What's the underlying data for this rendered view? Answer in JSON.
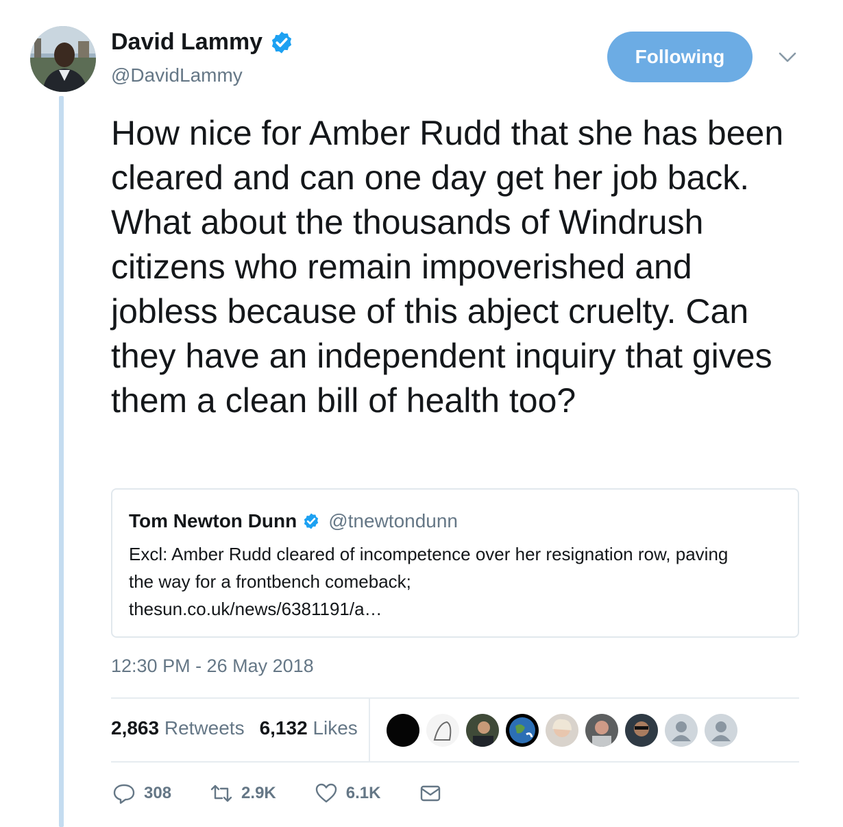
{
  "author": {
    "name": "David Lammy",
    "handle": "@DavidLammy",
    "verified": true
  },
  "follow_button": {
    "label": "Following"
  },
  "tweet": {
    "text": "How nice for Amber Rudd that she has been cleared and can one day get her job back. What about the thousands of Windrush citizens who remain impoverished and jobless because of this abject cruelty. Can they have an independent inquiry that gives them a clean bill of health too?"
  },
  "quoted_tweet": {
    "name": "Tom Newton Dunn",
    "handle": "@tnewtondunn",
    "verified": true,
    "text_line1": "Excl: Amber Rudd cleared of incompetence over her resignation row, paving",
    "text_line2": "the way for a frontbench comeback;",
    "link": "thesun.co.uk/news/6381191/a…"
  },
  "timestamp": "12:30 PM - 26 May 2018",
  "stats": {
    "retweets_count": "2,863",
    "retweets_label": "Retweets",
    "likes_count": "6,132",
    "likes_label": "Likes"
  },
  "actions": {
    "replies": "308",
    "retweets": "2.9K",
    "likes": "6.1K"
  },
  "colors": {
    "accent": "#6cace4",
    "verified": "#1da1f2",
    "secondary_text": "#657786",
    "thread_line": "#c4dcf0"
  }
}
